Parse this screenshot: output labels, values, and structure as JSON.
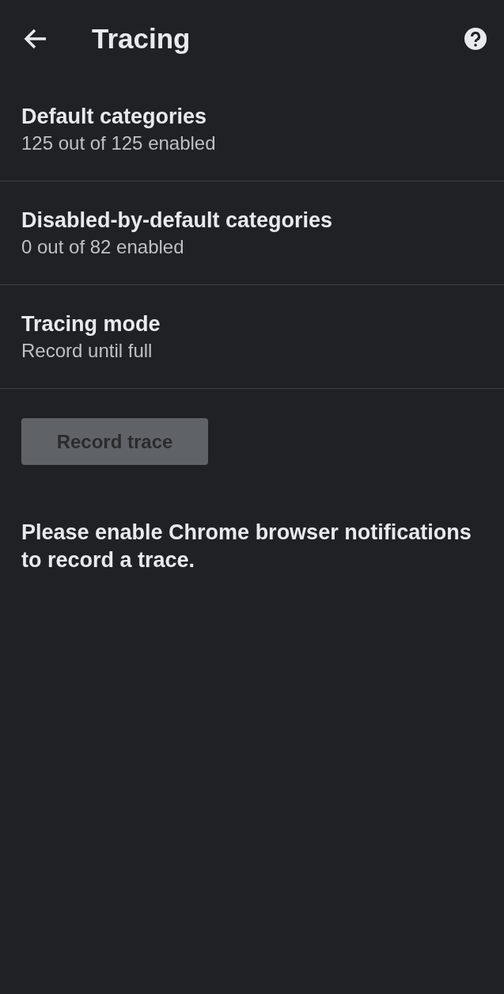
{
  "app_bar": {
    "title": "Tracing"
  },
  "settings": [
    {
      "title": "Default categories",
      "summary": "125 out of 125 enabled"
    },
    {
      "title": "Disabled-by-default categories",
      "summary": "0 out of 82 enabled"
    },
    {
      "title": "Tracing mode",
      "summary": "Record until full"
    }
  ],
  "record_button": {
    "label": "Record trace",
    "disabled": true
  },
  "message": "Please enable Chrome browser notifications to record a trace."
}
